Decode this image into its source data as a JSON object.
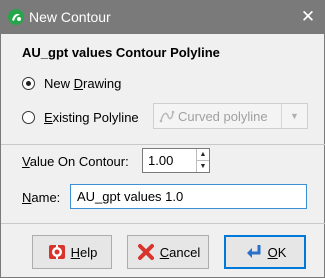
{
  "window": {
    "title": "New Contour",
    "close_icon": "close-icon",
    "app_icon": "app-logo-icon"
  },
  "heading": "AU_gpt values Contour Polyline",
  "radios": {
    "new_drawing": {
      "label_prefix": "New ",
      "label_accel": "D",
      "label_rest": "rawing",
      "checked": true
    },
    "existing": {
      "label_accel": "E",
      "label_rest": "xisting Polyline",
      "checked": false
    }
  },
  "polyline_select": {
    "selected": "Curved polyline",
    "icon": "curved-polyline-icon",
    "disabled": true
  },
  "value_on_contour": {
    "label_accel": "V",
    "label_rest": "alue On Contour:",
    "value": "1.00"
  },
  "name_field": {
    "label_accel": "N",
    "label_rest": "ame:",
    "value": "AU_gpt values 1.0"
  },
  "buttons": {
    "help": {
      "accel": "H",
      "rest": "elp",
      "icon": "help-lifebuoy-icon"
    },
    "cancel": {
      "accel": "C",
      "rest": "ancel",
      "icon": "cancel-x-icon"
    },
    "ok": {
      "accel": "O",
      "rest": "K",
      "icon": "ok-enter-arrow-icon"
    }
  },
  "colors": {
    "titlebar": "#7a7a7a",
    "focus_border": "#0078d7",
    "app_icon": "#27a54a"
  }
}
